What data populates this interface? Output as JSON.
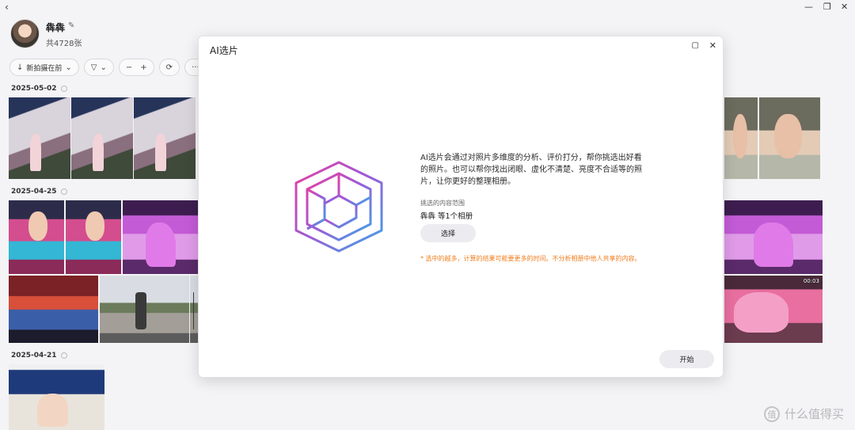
{
  "window": {
    "back_glyph": "‹",
    "minimize_glyph": "—",
    "restore_glyph": "❐",
    "close_glyph": "✕"
  },
  "album": {
    "title": "犇犇",
    "count": "共4728张"
  },
  "toolbar": {
    "sort_label": "新拍摄在前",
    "filter_label": "",
    "zoom_out": "−",
    "zoom_in": "+",
    "more": "···"
  },
  "gallery": {
    "dates": [
      "2025-05-02",
      "2025-04-25",
      "2025-04-21"
    ],
    "video_duration": "00:03"
  },
  "modal": {
    "title": "AI选片",
    "description": "AI选片会通过对照片多维度的分析、评价打分，帮你挑选出好看的照片。也可以帮你找出闭眼、虚化不清楚、亮度不合适等的照片，让你更好的整理相册。",
    "scope_label": "挑选的内容范围",
    "scope_value": "犇犇 等1个相册",
    "select_button": "选择",
    "warning": "* 选中的越多，计算的结果可能要更多的时间。不分析相册中他人共享的内容。",
    "start_button": "开始"
  },
  "watermark": {
    "text": "什么值得买",
    "glyph": "值"
  },
  "colors": {
    "accent_warning": "#f07d1c",
    "background": "#f4f4f6",
    "logo_gradient": [
      "#e83fa0",
      "#9b5bd8",
      "#3aa6e8"
    ]
  }
}
